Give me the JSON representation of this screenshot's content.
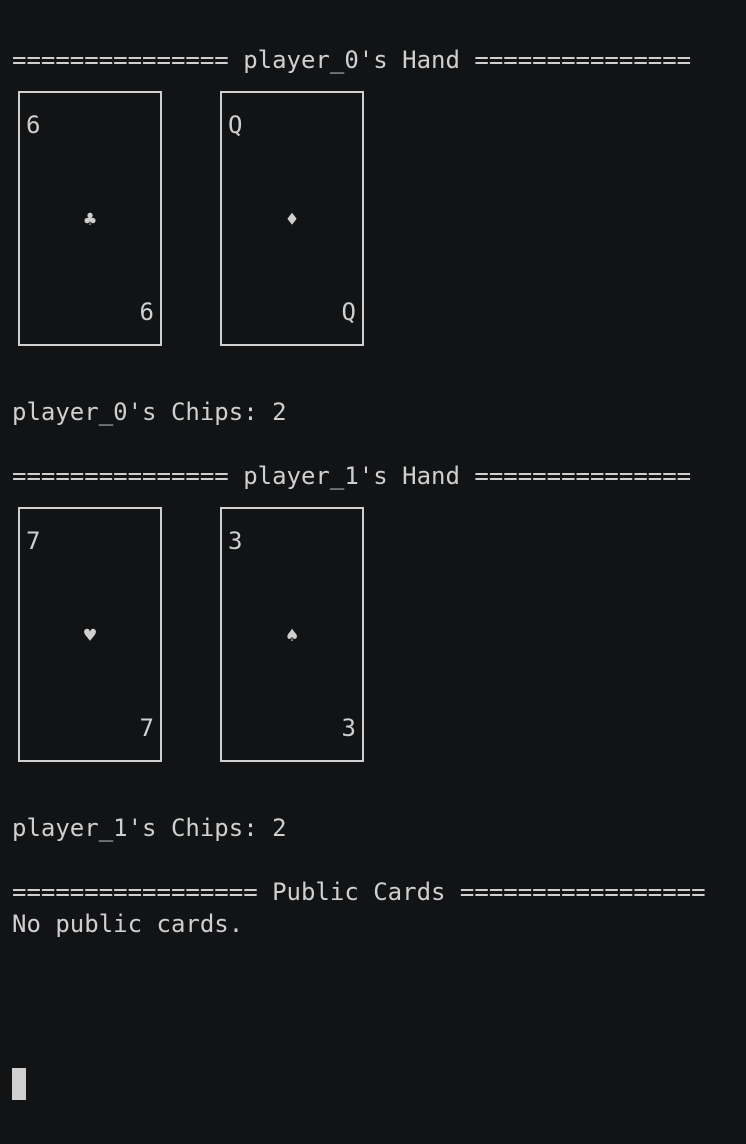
{
  "players": [
    {
      "hand_header": "=============== player_0's Hand ===============",
      "cards": [
        {
          "rank": "6",
          "suit": "♣",
          "suit_name": "clubs"
        },
        {
          "rank": "Q",
          "suit": "♦",
          "suit_name": "diamonds"
        }
      ],
      "chips_text": "player_0's Chips: 2"
    },
    {
      "hand_header": "=============== player_1's Hand ===============",
      "cards": [
        {
          "rank": "7",
          "suit": "♥",
          "suit_name": "hearts"
        },
        {
          "rank": "3",
          "suit": "♠",
          "suit_name": "spades"
        }
      ],
      "chips_text": "player_1's Chips: 2"
    }
  ],
  "public": {
    "header": "================= Public Cards =================",
    "status": "No public cards."
  },
  "colors": {
    "background": "#121315",
    "foreground": "#cfcfcf"
  }
}
